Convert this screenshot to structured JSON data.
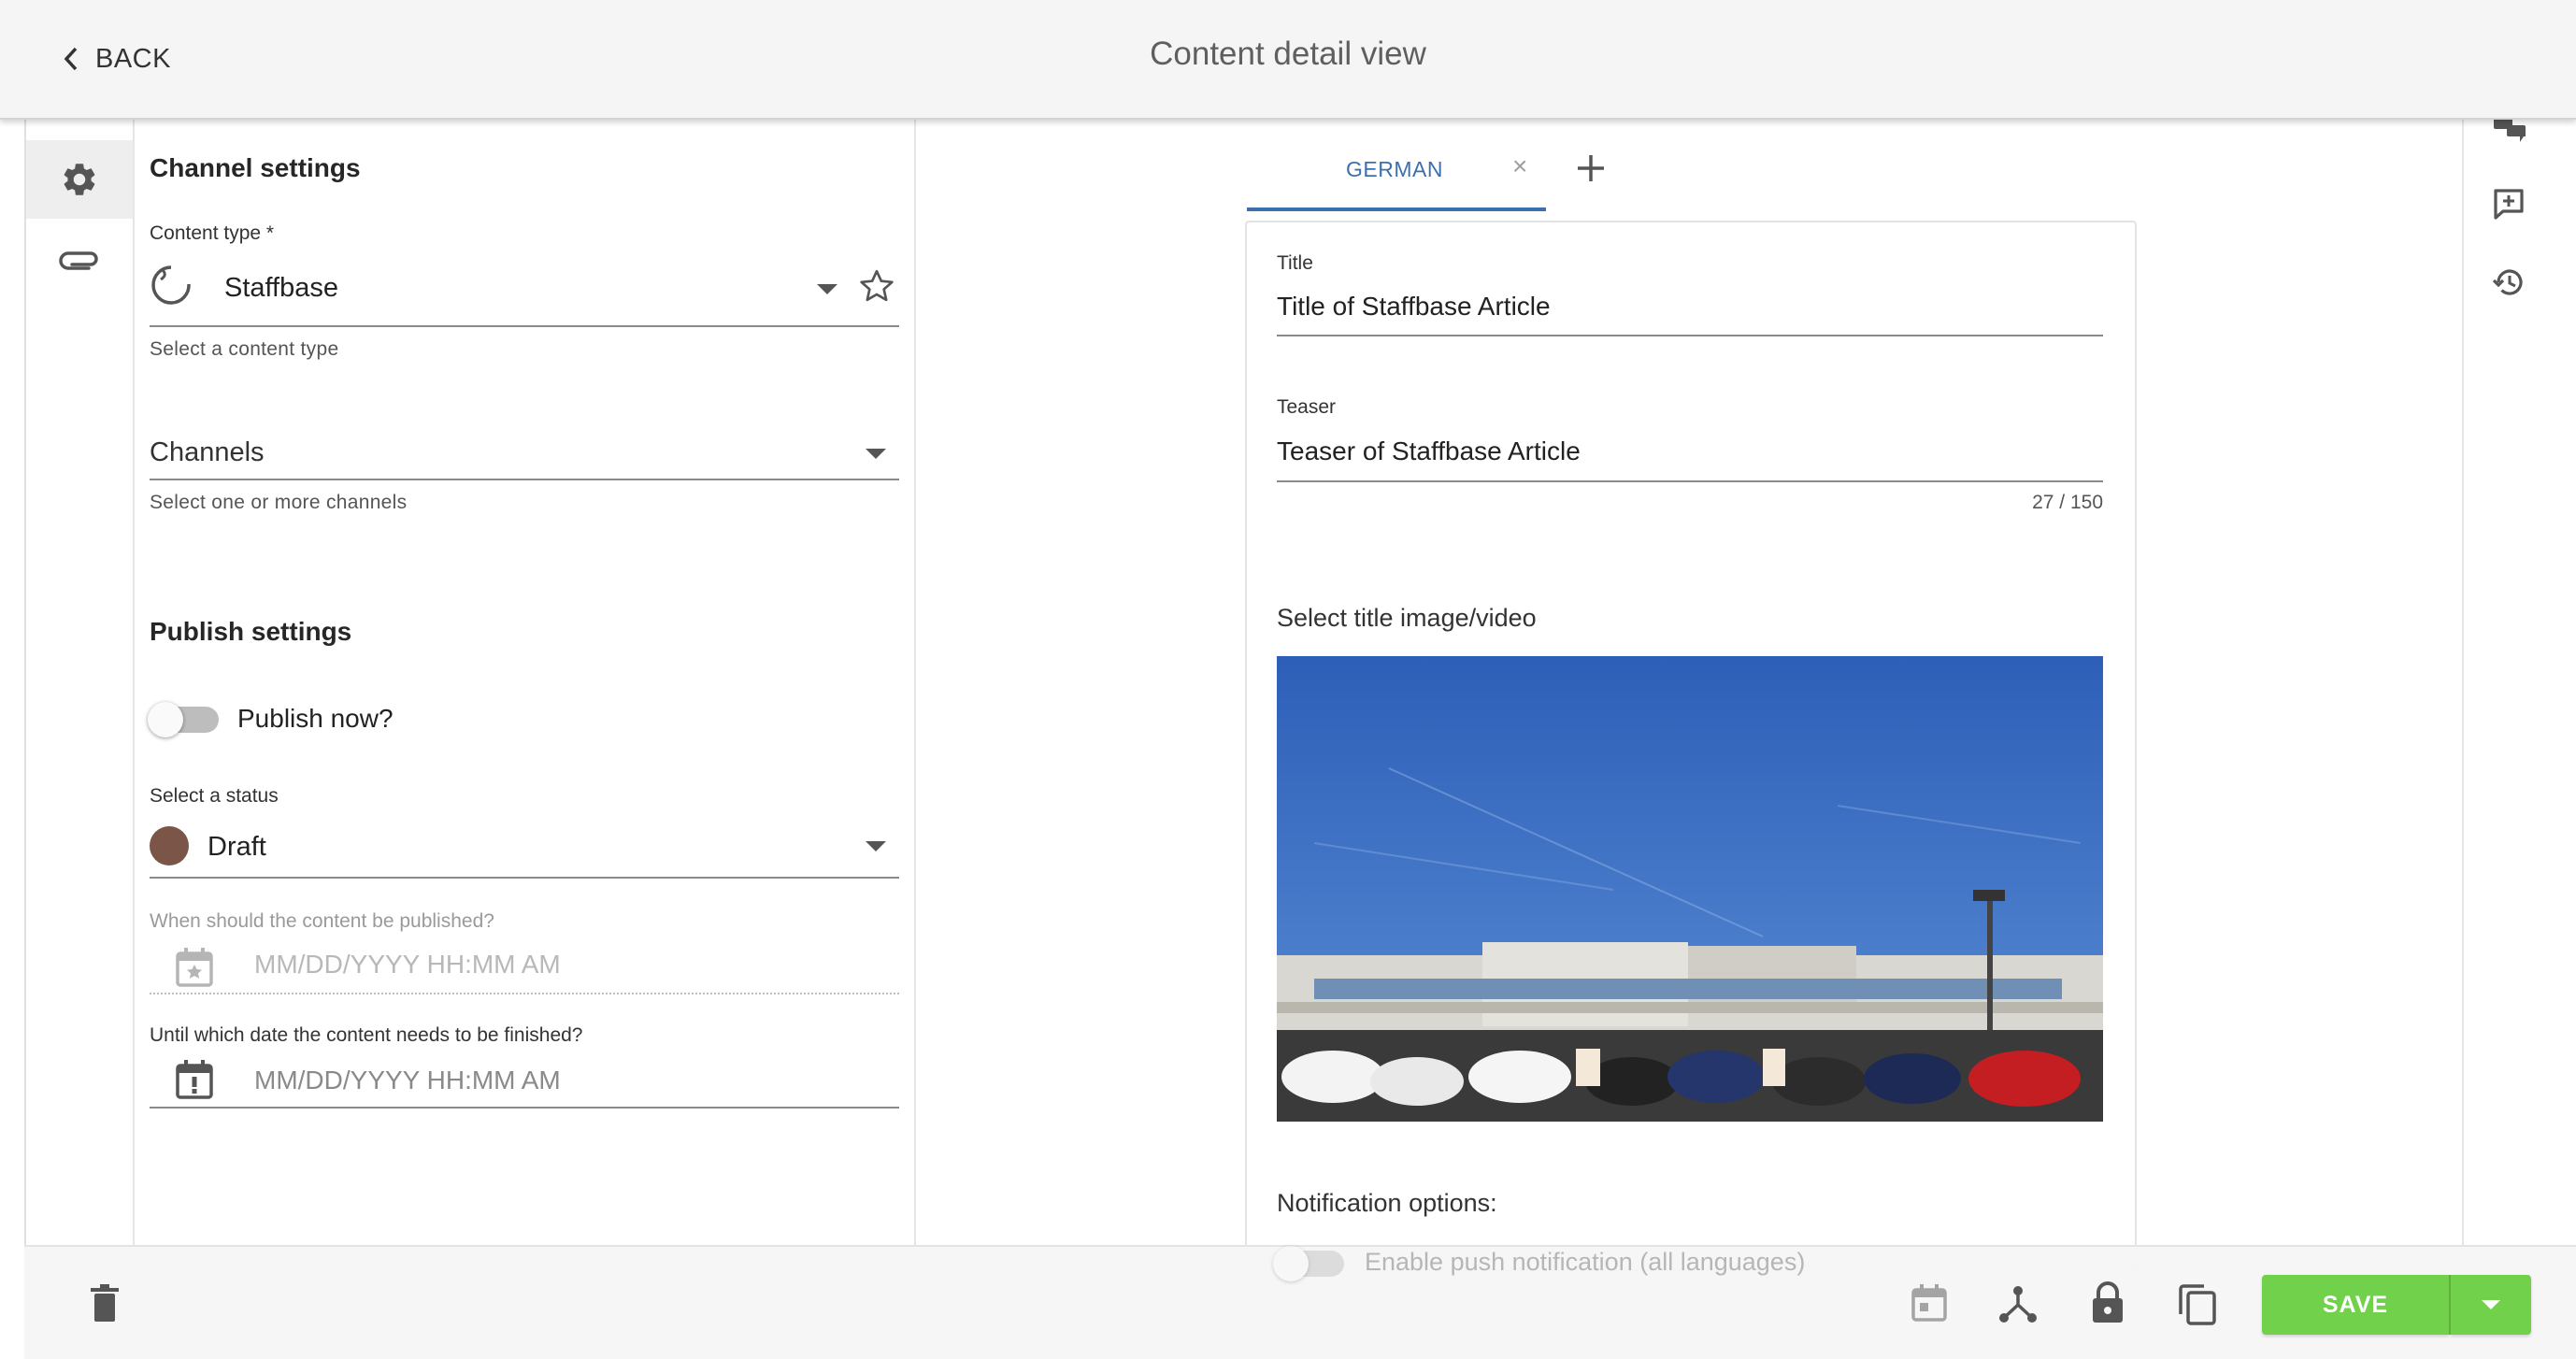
{
  "header": {
    "back_label": "BACK",
    "title": "Content detail view"
  },
  "channel_settings": {
    "heading": "Channel settings",
    "content_type_label": "Content type *",
    "content_type_value": "Staffbase",
    "content_type_hint": "Select a content type",
    "channels_placeholder": "Channels",
    "channels_hint": "Select one or more channels"
  },
  "publish_settings": {
    "heading": "Publish settings",
    "publish_now_label": "Publish now?",
    "publish_now_on": false,
    "status_label": "Select a status",
    "status_value": "Draft",
    "status_color": "#7a5548",
    "publish_date_label": "When should the content be published?",
    "publish_date_placeholder": "MM/DD/YYYY HH:MM AM",
    "finish_date_label": "Until which date the content needs to be finished?",
    "finish_date_placeholder": "MM/DD/YYYY HH:MM AM"
  },
  "editor": {
    "language_tab": "GERMAN",
    "title_label": "Title",
    "title_value": "Title of Staffbase Article",
    "teaser_label": "Teaser",
    "teaser_value": "Teaser of Staffbase Article",
    "teaser_counter": "27 / 150",
    "image_label": "Select title image/video",
    "notification_label": "Notification options:",
    "push_label": "Enable push notification (all languages)"
  },
  "footer": {
    "save_label": "SAVE"
  },
  "colors": {
    "accent_blue": "#3d6fb0",
    "save_green": "#72d14b"
  }
}
